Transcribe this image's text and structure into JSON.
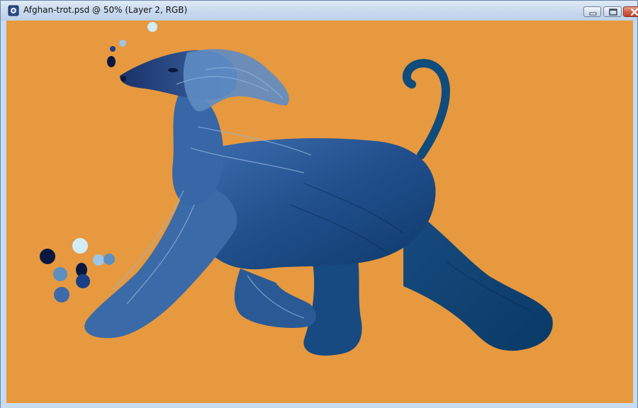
{
  "window": {
    "title": "Afghan-trot.psd @ 50% (Layer 2, RGB)",
    "app_icon": "photoshop-document-icon",
    "controls": {
      "minimize_icon": "minimize-icon",
      "maximize_icon": "maximize-icon",
      "close_icon": "close-icon"
    }
  },
  "canvas": {
    "background_color": "#e6993f",
    "subject": "afghan-hound-painting",
    "palette_colors": [
      "#0a1840",
      "#1a3f86",
      "#5d8fc0",
      "#9ec6e6",
      "#d2ecf8",
      "#154f80"
    ]
  }
}
